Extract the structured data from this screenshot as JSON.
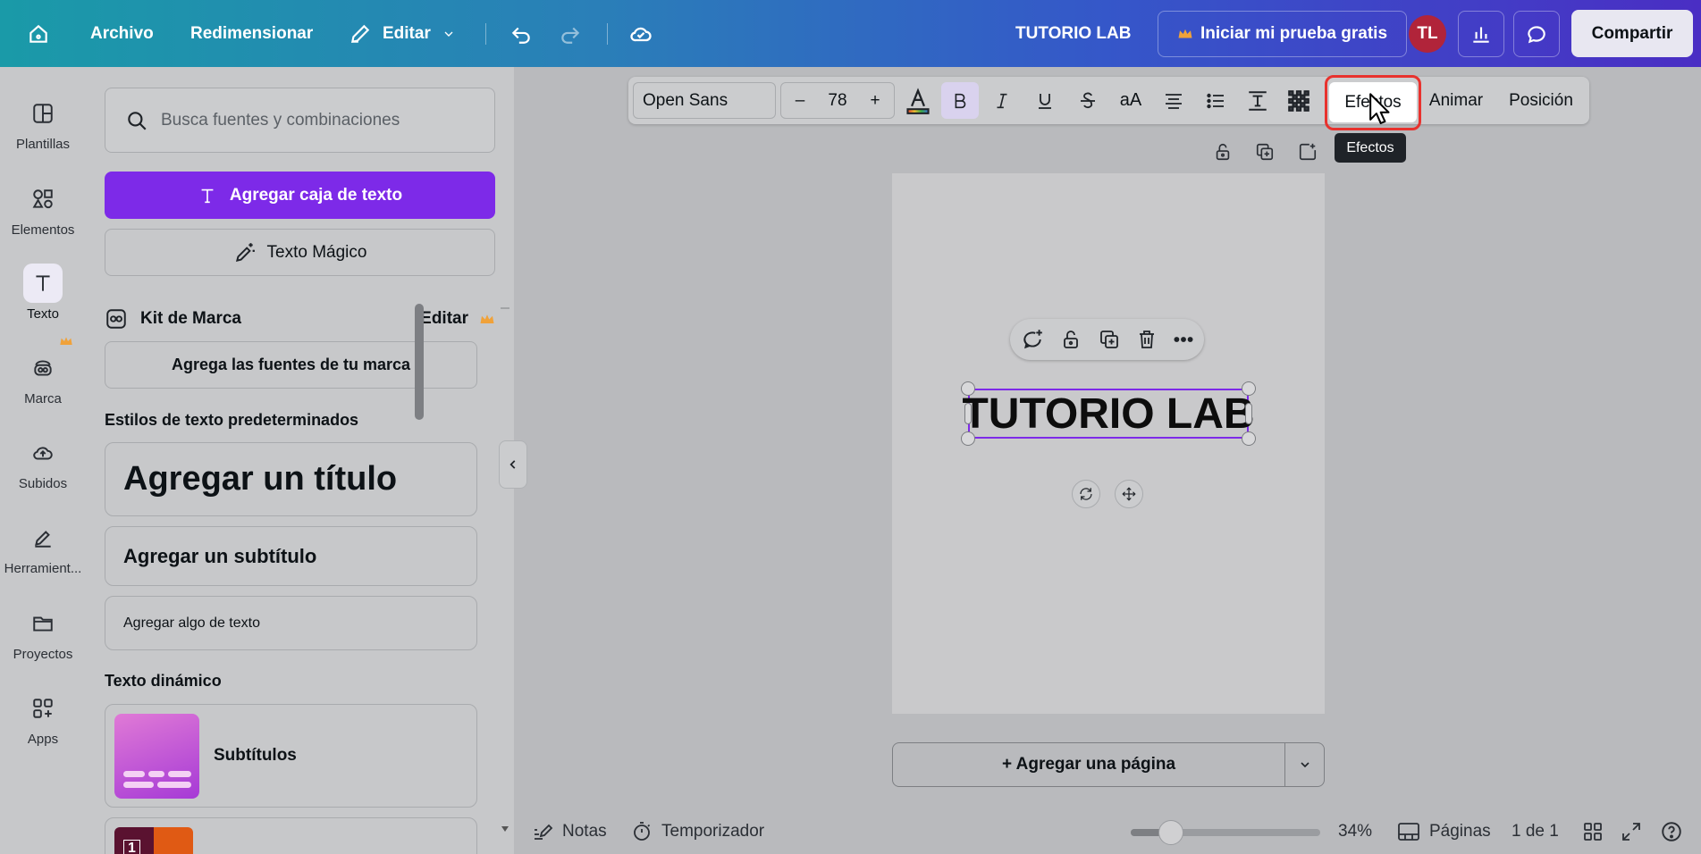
{
  "header": {
    "archivo": "Archivo",
    "redimensionar": "Redimensionar",
    "editar": "Editar",
    "doc_title": "TUTORIO LAB",
    "trial": "Iniciar mi prueba gratis",
    "avatar": "TL",
    "share": "Compartir"
  },
  "rail": [
    {
      "label": "Plantillas",
      "icon": "templates-icon"
    },
    {
      "label": "Elementos",
      "icon": "elements-icon"
    },
    {
      "label": "Texto",
      "icon": "text-icon"
    },
    {
      "label": "Marca",
      "icon": "brand-icon"
    },
    {
      "label": "Subidos",
      "icon": "cloud-upload-icon"
    },
    {
      "label": "Herramient...",
      "icon": "draw-tool-icon"
    },
    {
      "label": "Proyectos",
      "icon": "folder-icon"
    },
    {
      "label": "Apps",
      "icon": "apps-icon"
    }
  ],
  "panel": {
    "search_placeholder": "Busca fuentes y combinaciones",
    "add_textbox": "Agregar caja de texto",
    "magic_text": "Texto Mágico",
    "brand_kit": "Kit de Marca",
    "brand_edit": "Editar",
    "brand_fonts": "Agrega las fuentes de tu marca",
    "default_styles": "Estilos de texto predeterminados",
    "add_title": "Agregar un título",
    "add_subtitle": "Agregar un subtítulo",
    "add_body": "Agregar algo de texto",
    "dynamic_text": "Texto dinámico",
    "subtitles": "Subtítulos",
    "second_card_number": "1"
  },
  "toolbar": {
    "font": "Open Sans",
    "minus": "–",
    "size": "78",
    "plus": "+",
    "case": "aA",
    "effects": "Efectos",
    "animate": "Animar",
    "position": "Posición",
    "tooltip": "Efectos"
  },
  "canvas": {
    "text": "TUTORIO LAB",
    "add_page": "+ Agregar una página"
  },
  "bottom": {
    "notes": "Notas",
    "timer": "Temporizador",
    "zoom": "34%",
    "zoom_fraction": 0.34,
    "pages": "Páginas",
    "page_count": "1 de 1"
  },
  "colors": {
    "accent": "#7d2ae8",
    "highlight": "#e8322e",
    "crown": "#f0a23a"
  }
}
